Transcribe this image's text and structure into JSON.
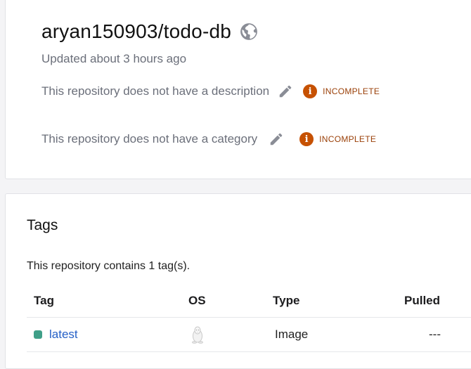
{
  "repository": {
    "name": "aryan150903/todo-db",
    "visibility_icon": "globe-icon",
    "updated": "Updated about 3 hours ago",
    "description_text": "This repository does not have a description",
    "category_text": "This repository does not have a category",
    "edit_icon": "pencil-icon",
    "status_badge": "INCOMPLETE",
    "status_icon_glyph": "i",
    "colors": {
      "badge": "#c65102",
      "badge_text": "#9a3f07"
    }
  },
  "tags_section": {
    "title": "Tags",
    "summary": "This repository contains 1 tag(s).",
    "columns": [
      "Tag",
      "OS",
      "Type",
      "Pulled"
    ],
    "rows": [
      {
        "tag": "latest",
        "os_icon": "linux-icon",
        "type": "Image",
        "pulled": "---",
        "status_color": "#3f9f88"
      }
    ]
  }
}
